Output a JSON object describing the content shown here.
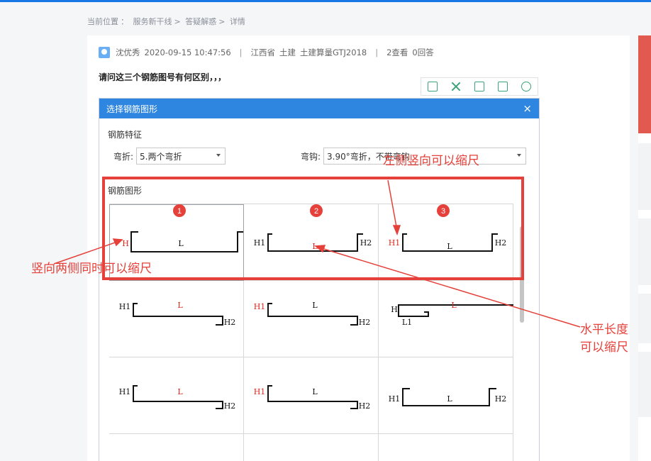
{
  "breadcrumb": [
    "当前位置",
    "：",
    "服务新干线",
    ">",
    "答疑解惑",
    ">",
    "详情"
  ],
  "meta": {
    "author": "沈优秀",
    "datetime": "2020-09-15 10:47:56",
    "sep": "|",
    "region": "江西省",
    "category": "土建",
    "product": "土建算量GTJ2018",
    "views": "2查看",
    "answers": "0回答"
  },
  "question": "请问这三个钢筋图号有何区别，，，",
  "toolbar": [
    "book-icon",
    "expand-icon",
    "save-icon",
    "share-icon",
    "settings-icon"
  ],
  "dialog": {
    "title": "选择钢筋图形",
    "close": "×",
    "feature_label": "钢筋特征",
    "bend_label": "弯折:",
    "bend_value": "5.两个弯折",
    "hook_label": "弯钩:",
    "hook_value": "3.90°弯折，不带弯钩",
    "shape_label": "钢筋图形"
  },
  "shapes": [
    {
      "labels": [
        "H",
        "L"
      ],
      "red": [
        0
      ]
    },
    {
      "labels": [
        "H1",
        "L",
        "H2"
      ],
      "red": [
        1
      ]
    },
    {
      "labels": [
        "H1",
        "L",
        "H2"
      ],
      "red": [
        0
      ]
    },
    {
      "labels": [
        "H1",
        "L",
        "H2"
      ],
      "red": [
        1
      ]
    },
    {
      "labels": [
        "H1",
        "L",
        "H2"
      ],
      "red": [
        0
      ]
    },
    {
      "labels": [
        "H",
        "L",
        "L1"
      ],
      "red": [
        1
      ]
    },
    {
      "labels": [
        "H1",
        "L",
        "H2"
      ],
      "red": [
        1
      ]
    },
    {
      "labels": [
        "H1",
        "L",
        "H2"
      ],
      "red": [
        0
      ]
    },
    {
      "labels": [
        "H1",
        "L",
        "H2"
      ],
      "red": []
    }
  ],
  "badges": [
    "1",
    "2",
    "3"
  ],
  "annotations": {
    "left_side": "左侧竖向可以缩尺",
    "both_sides": "竖向两侧同时可以缩尺",
    "horizontal_1": "水平长度",
    "horizontal_2": "可以缩尺"
  },
  "colors": {
    "accent_blue": "#2f86e0",
    "annotation_red": "#e5403a",
    "label_red": "#e0251b"
  }
}
